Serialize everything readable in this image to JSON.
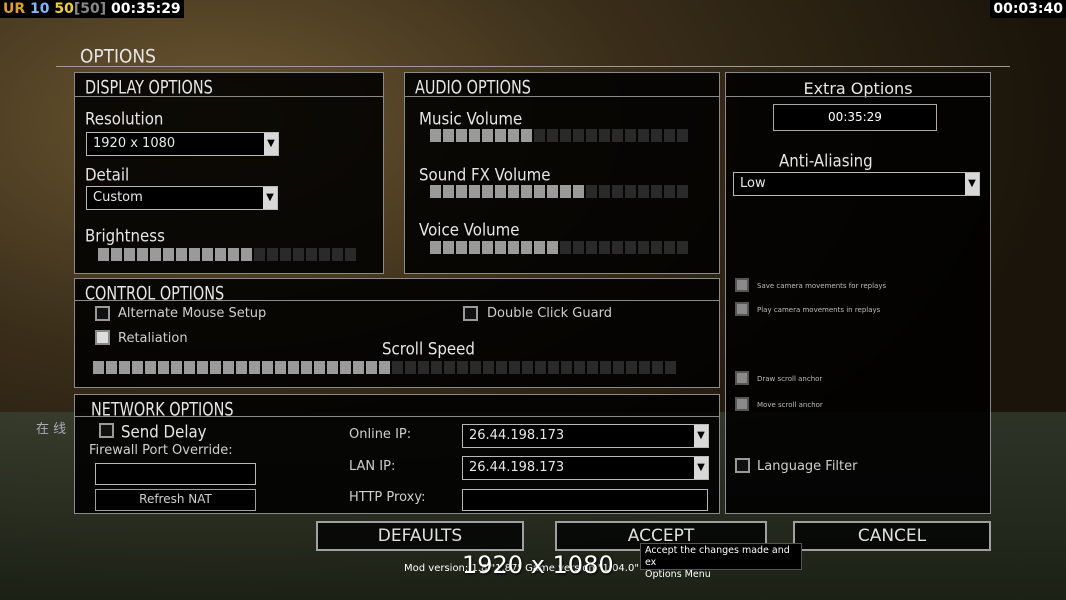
{
  "hud": {
    "left_parts": [
      {
        "text": "UR",
        "color": "#e0a020"
      },
      {
        "text": "10",
        "color": "#7fb7ff"
      },
      {
        "text": "50",
        "color": "#f0d020"
      },
      {
        "text": "[50]",
        "color": "#888888"
      },
      {
        "text": "00:35:29",
        "color": "#ffffff"
      }
    ],
    "right_time": "00:03:40"
  },
  "options": {
    "title": "OPTIONS"
  },
  "display": {
    "title": "DISPLAY OPTIONS",
    "resolution_label": "Resolution",
    "resolution_value": "1920 x 1080",
    "detail_label": "Detail",
    "detail_value": "Custom",
    "brightness_label": "Brightness",
    "brightness_level": 0.6
  },
  "audio": {
    "title": "AUDIO OPTIONS",
    "music_label": "Music Volume",
    "music_level": 0.4,
    "sfx_label": "Sound FX Volume",
    "sfx_level": 0.6,
    "voice_label": "Voice Volume",
    "voice_level": 0.5
  },
  "extra": {
    "title": "Extra Options",
    "clock": "00:35:29",
    "aa_label": "Anti-Aliasing",
    "aa_value": "Low",
    "save_camera": "Save camera movements for replays",
    "play_camera": "Play camera movements in replays",
    "draw_anchor": "Draw scroll anchor",
    "move_anchor": "Move scroll anchor",
    "language_filter": "Language Filter"
  },
  "control": {
    "title": "CONTROL OPTIONS",
    "alt_mouse": "Alternate Mouse Setup",
    "double_click": "Double Click Guard",
    "retaliation": "Retaliation",
    "scroll_label": "Scroll Speed",
    "scroll_level": 0.5
  },
  "network": {
    "title": "NETWORK OPTIONS",
    "send_delay": "Send Delay",
    "firewall_label": "Firewall Port Override:",
    "refresh_nat": "Refresh NAT",
    "online_ip_label": "Online IP:",
    "online_ip": "26.44.198.173",
    "lan_ip_label": "LAN IP:",
    "lan_ip": "26.44.198.173",
    "http_proxy_label": "HTTP Proxy:"
  },
  "buttons": {
    "defaults": "DEFAULTS",
    "accept": "ACCEPT",
    "cancel": "CANCEL"
  },
  "tooltip": {
    "line1": "Accept the changes made and ex",
    "line2": "Options Menu"
  },
  "footer": {
    "mod_version": "Mod version: 1.8 \"1.87\" Game version \"1.04.0\"",
    "resolution_overlay": "1920 x 1080"
  },
  "background": {
    "chinese_text": "在 线"
  }
}
